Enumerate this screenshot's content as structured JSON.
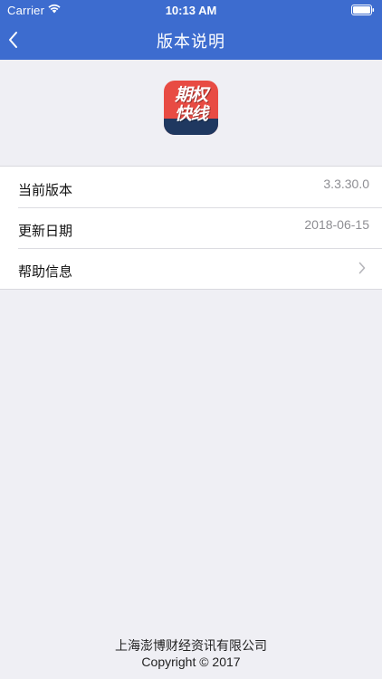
{
  "status_bar": {
    "carrier": "Carrier",
    "time": "10:13 AM",
    "wifi_icon": "wifi-icon",
    "battery_icon": "battery-icon"
  },
  "nav": {
    "title": "版本说明",
    "back_icon": "chevron-left-icon"
  },
  "logo": {
    "text_line1": "期权",
    "text_line2": "快线",
    "colors": {
      "top": "#e84b43",
      "bottom": "#1f3860"
    }
  },
  "rows": [
    {
      "label": "当前版本",
      "value": "3.3.30.0"
    },
    {
      "label": "更新日期",
      "value": "2018-06-15"
    },
    {
      "label": "帮助信息",
      "value": "",
      "icon": "chevron-right-icon"
    }
  ],
  "footer": {
    "company": "上海澎博财经资讯有限公司",
    "copyright": "Copyright ©  2017"
  },
  "colors": {
    "accent": "#3d6ccf",
    "background": "#efeff4"
  }
}
